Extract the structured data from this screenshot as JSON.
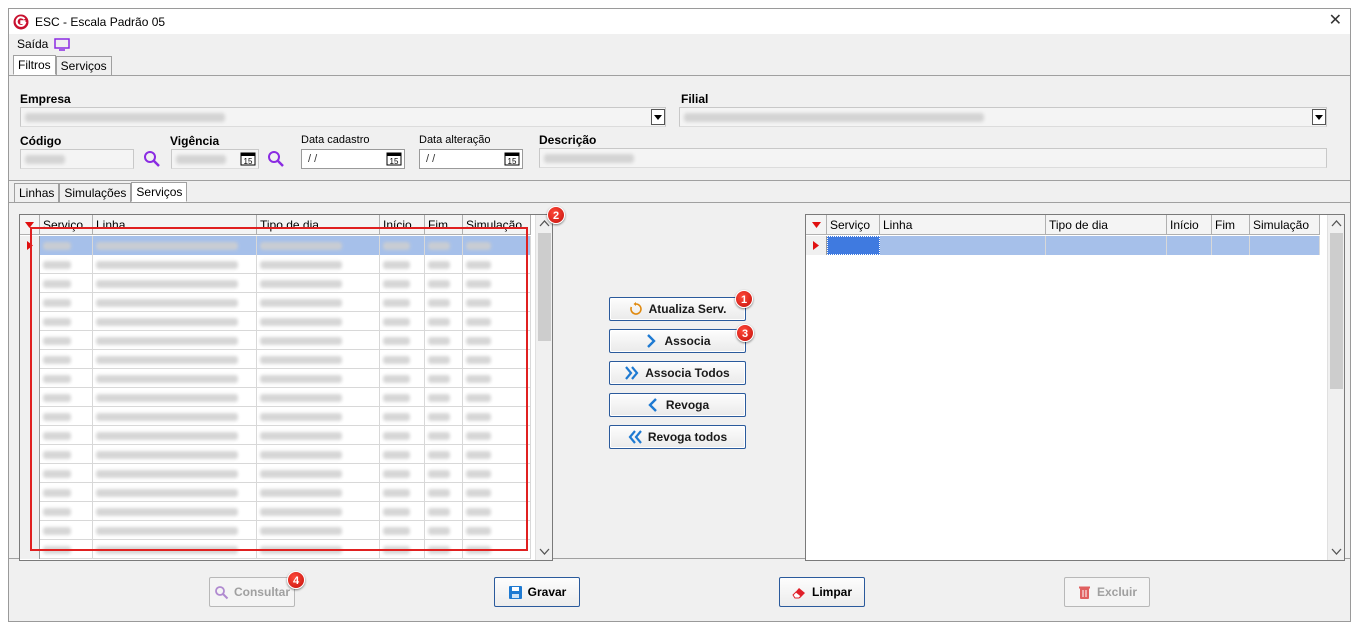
{
  "window": {
    "title": "ESC - Escala Padrão 05",
    "close": "✕"
  },
  "menu": {
    "saida": "Saída"
  },
  "top_tabs": [
    "Filtros",
    "Serviços"
  ],
  "filters": {
    "empresa_label": "Empresa",
    "filial_label": "Filial",
    "codigo_label": "Código",
    "vigencia_label": "Vigência",
    "data_cadastro_label": "Data cadastro",
    "data_cadastro_value": "/ /",
    "data_alteracao_label": "Data alteração",
    "data_alteracao_value": "/ /",
    "descricao_label": "Descrição",
    "cal_num": "15"
  },
  "inner_tabs": [
    "Linhas",
    "Simulações",
    "Serviços"
  ],
  "left_grid": {
    "columns": [
      "Serviço",
      "Linha",
      "Tipo de dia",
      "Início",
      "Fim",
      "Simulação"
    ],
    "row_count": 17
  },
  "right_grid": {
    "columns": [
      "Serviço",
      "Linha",
      "Tipo de dia",
      "Início",
      "Fim",
      "Simulação"
    ]
  },
  "actions": {
    "atualiza": "Atualiza Serv.",
    "associa": "Associa",
    "associa_todos": "Associa Todos",
    "revoga": "Revoga",
    "revoga_todos": "Revoga todos"
  },
  "bottom": {
    "consultar": "Consultar",
    "gravar": "Gravar",
    "limpar": "Limpar",
    "excluir": "Excluir"
  },
  "badges": [
    "1",
    "2",
    "3",
    "4"
  ],
  "colors": {
    "accent_purple": "#8a2be2",
    "button_blue": "#2a5a9c",
    "selection": "#a6c0ea",
    "annotation_red": "#e02020",
    "indicator_red": "#e01010"
  }
}
